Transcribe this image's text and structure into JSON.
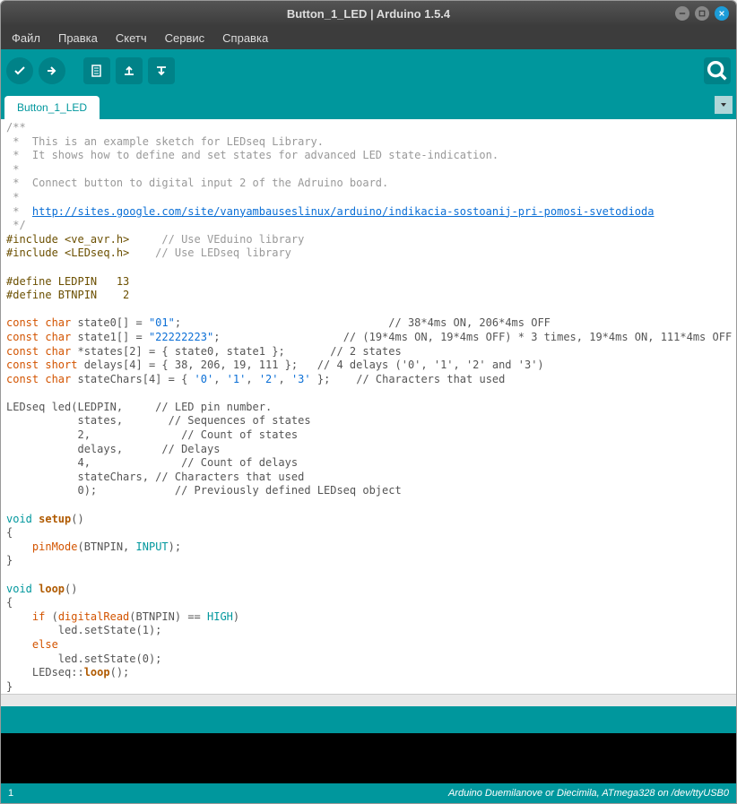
{
  "titlebar": {
    "title": "Button_1_LED | Arduino 1.5.4"
  },
  "menu": {
    "file": "Файл",
    "edit": "Правка",
    "sketch": "Скетч",
    "service": "Сервис",
    "help": "Справка"
  },
  "tab": {
    "name": "Button_1_LED"
  },
  "status": {
    "line": "1",
    "board": "Arduino Duemilanove or Diecimila, ATmega328 on /dev/ttyUSB0"
  },
  "code": {
    "l1": "/**",
    "l2": " *  This is an example sketch for LEDseq Library.",
    "l3": " *  It shows how to define and set states for advanced LED state-indication.",
    "l4": " *",
    "l5": " *  Connect button to digital input 2 of the Adruino board.",
    "l6": " *",
    "l7a": " *  ",
    "l7link": "http://sites.google.com/site/vanyambauseslinux/arduino/indikacia-sostoanij-pri-pomosi-svetodioda",
    "l8": " */",
    "l9a": "#include <ve_avr.h>",
    "l9b": "     // Use VEduino library",
    "l10a": "#include <LEDseq.h>",
    "l10b": "    // Use LEDseq library",
    "l12": "#define LEDPIN   13",
    "l13": "#define BTNPIN    2",
    "l15a": "const",
    "l15b": " char",
    "l15c": " state0[] = ",
    "l15d": "\"01\"",
    "l15e": ";                                // 38*4ms ON, 206*4ms OFF",
    "l16a": "const",
    "l16b": " char",
    "l16c": " state1[] = ",
    "l16d": "\"22222223\"",
    "l16e": ";                   // (19*4ms ON, 19*4ms OFF) * 3 times, 19*4ms ON, 111*4ms OFF",
    "l17a": "const",
    "l17b": " char",
    "l17c": " *states[2] = { state0, state1 };       // 2 states",
    "l18a": "const",
    "l18b": " short",
    "l18c": " delays[4] = { 38, 206, 19, 111 };   // 4 delays ('0', '1', '2' and '3')",
    "l19a": "const",
    "l19b": " char",
    "l19c": " stateChars[4] = { ",
    "l19d": "'0'",
    "l19e": ", ",
    "l19f": "'1'",
    "l19g": ", ",
    "l19h": "'2'",
    "l19i": ", ",
    "l19j": "'3'",
    "l19k": " };    // Characters that used",
    "l21": "LEDseq led(LEDPIN,     // LED pin number.",
    "l22": "           states,       // Sequences of states",
    "l23": "           2,              // Count of states",
    "l24": "           delays,      // Delays",
    "l25": "           4,              // Count of delays",
    "l26": "           stateChars, // Characters that used",
    "l27": "           0);            // Previously defined LEDseq object",
    "l29a": "void",
    "l29b": " setup",
    "l29c": "()",
    "l30": "{",
    "l31a": "    pinMode",
    "l31b": "(BTNPIN, ",
    "l31c": "INPUT",
    "l31d": ");",
    "l32": "}",
    "l34a": "void",
    "l34b": " loop",
    "l34c": "()",
    "l35": "{",
    "l36a": "    if",
    "l36b": " (",
    "l36c": "digitalRead",
    "l36d": "(BTNPIN) == ",
    "l36e": "HIGH",
    "l36f": ")",
    "l37": "        led.setState(1);",
    "l38a": "    else",
    "l39": "        led.setState(0);",
    "l40a": "    LEDseq::",
    "l40b": "loop",
    "l40c": "();",
    "l41": "}"
  }
}
